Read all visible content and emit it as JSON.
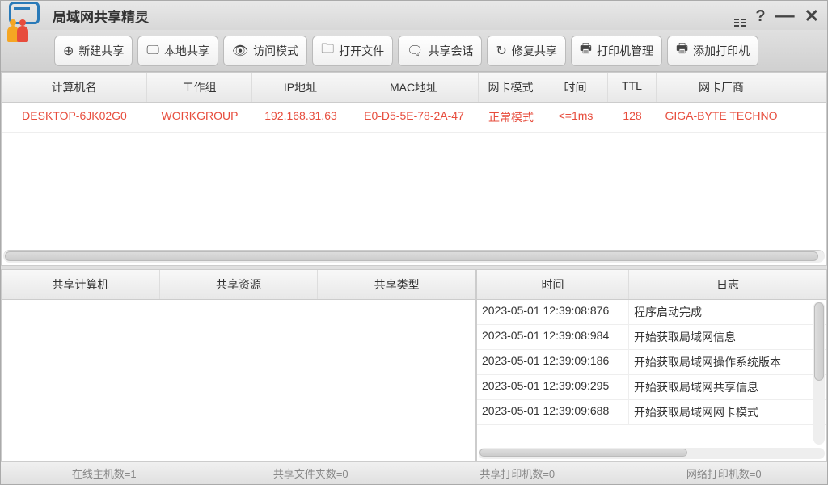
{
  "app": {
    "title": "局域网共享精灵"
  },
  "toolbar": {
    "new_share": "新建共享",
    "local_share": "本地共享",
    "access_mode": "访问模式",
    "open_file": "打开文件",
    "share_session": "共享会话",
    "repair_share": "修复共享",
    "printer_mgmt": "打印机管理",
    "add_printer": "添加打印机"
  },
  "main_table": {
    "headers": [
      "计算机名",
      "工作组",
      "IP地址",
      "MAC地址",
      "网卡模式",
      "时间",
      "TTL",
      "网卡厂商"
    ],
    "rows": [
      {
        "computer": "DESKTOP-6JK02G0",
        "workgroup": "WORKGROUP",
        "ip": "192.168.31.63",
        "mac": "E0-D5-5E-78-2A-47",
        "nic_mode": "正常模式",
        "time": "<=1ms",
        "ttl": "128",
        "vendor": "GIGA-BYTE TECHNO"
      }
    ]
  },
  "share_table": {
    "headers": [
      "共享计算机",
      "共享资源",
      "共享类型"
    ]
  },
  "log_table": {
    "headers": [
      "时间",
      "日志"
    ],
    "rows": [
      {
        "t": "2023-05-01 12:39:08:876",
        "m": "程序启动完成"
      },
      {
        "t": "2023-05-01 12:39:08:984",
        "m": "开始获取局域网信息"
      },
      {
        "t": "2023-05-01 12:39:09:186",
        "m": "开始获取局域网操作系统版本"
      },
      {
        "t": "2023-05-01 12:39:09:295",
        "m": "开始获取局域网共享信息"
      },
      {
        "t": "2023-05-01 12:39:09:688",
        "m": "开始获取局域网网卡模式"
      }
    ]
  },
  "status": {
    "online_hosts": "在线主机数=1",
    "share_folders": "共享文件夹数=0",
    "share_printers": "共享打印机数=0",
    "net_printers": "网络打印机数=0"
  }
}
